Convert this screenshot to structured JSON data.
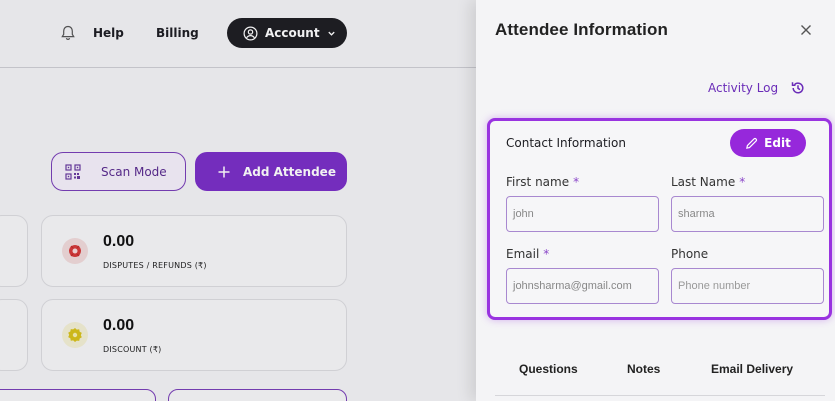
{
  "topbar": {
    "help_label": "Help",
    "billing_label": "Billing",
    "account_label": "Account"
  },
  "actions": {
    "scan_mode_label": "Scan Mode",
    "add_attendee_label": "Add Attendee"
  },
  "stats": [
    {
      "value": "0.00",
      "label": "DISPUTES / REFUNDS (₹)",
      "icon": "dispute-icon",
      "color": "#d63a3a"
    },
    {
      "value": "0.00",
      "label": "DISCOUNT (₹)",
      "icon": "discount-icon",
      "color": "#d8c21a"
    }
  ],
  "drawer": {
    "title": "Attendee Information",
    "activity_log_label": "Activity Log",
    "contact": {
      "title": "Contact Information",
      "edit_label": "Edit",
      "first_name_label": "First name",
      "first_name_value": "john",
      "last_name_label": "Last Name",
      "last_name_value": "sharma",
      "email_label": "Email",
      "email_value": "johnsharma@gmail.com",
      "phone_label": "Phone",
      "phone_placeholder": "Phone number",
      "required_mark": "*"
    },
    "tabs": [
      "Questions",
      "Notes",
      "Email Delivery"
    ]
  },
  "colors": {
    "accent": "#7b2fc7",
    "edit_button": "#9628db",
    "highlight_border": "#9933e0"
  }
}
